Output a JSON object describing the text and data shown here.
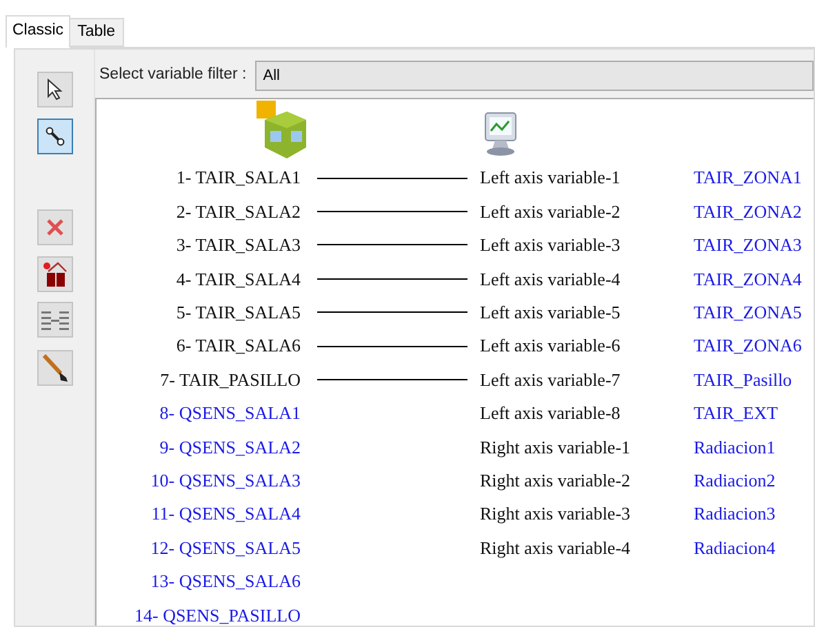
{
  "tabs": [
    {
      "label": "Classic",
      "selected": true
    },
    {
      "label": "Table",
      "selected": false
    }
  ],
  "tools": [
    {
      "kind": "pointer",
      "selected": false
    },
    {
      "kind": "link",
      "selected": true
    },
    {
      "kind": "delete",
      "selected": false
    },
    {
      "kind": "remove-all",
      "selected": false
    },
    {
      "kind": "align",
      "selected": false
    },
    {
      "kind": "brush",
      "selected": false
    }
  ],
  "filter": {
    "label": "Select variable filter :",
    "value": "All"
  },
  "sources": [
    {
      "label": "1- TAIR_SALA1",
      "connected": true
    },
    {
      "label": "2- TAIR_SALA2",
      "connected": true
    },
    {
      "label": "3- TAIR_SALA3",
      "connected": true
    },
    {
      "label": "4- TAIR_SALA4",
      "connected": true
    },
    {
      "label": "5- TAIR_SALA5",
      "connected": true
    },
    {
      "label": "6- TAIR_SALA6",
      "connected": true
    },
    {
      "label": "7- TAIR_PASILLO",
      "connected": true
    },
    {
      "label": "8- QSENS_SALA1",
      "connected": false
    },
    {
      "label": "9- QSENS_SALA2",
      "connected": false
    },
    {
      "label": "10- QSENS_SALA3",
      "connected": false
    },
    {
      "label": "11- QSENS_SALA4",
      "connected": false
    },
    {
      "label": "12- QSENS_SALA5",
      "connected": false
    },
    {
      "label": "13- QSENS_SALA6",
      "connected": false
    },
    {
      "label": "14- QSENS_PASILLO",
      "connected": false
    }
  ],
  "targets": [
    {
      "label": "Left axis variable-1",
      "variable": "TAIR_ZONA1"
    },
    {
      "label": "Left axis variable-2",
      "variable": "TAIR_ZONA2"
    },
    {
      "label": "Left axis variable-3",
      "variable": "TAIR_ZONA3"
    },
    {
      "label": "Left axis variable-4",
      "variable": "TAIR_ZONA4"
    },
    {
      "label": "Left axis variable-5",
      "variable": "TAIR_ZONA5"
    },
    {
      "label": "Left axis variable-6",
      "variable": "TAIR_ZONA6"
    },
    {
      "label": "Left axis variable-7",
      "variable": "TAIR_Pasillo"
    },
    {
      "label": "Left axis variable-8",
      "variable": "TAIR_EXT"
    },
    {
      "label": "Right axis variable-1",
      "variable": "Radiacion1"
    },
    {
      "label": "Right axis variable-2",
      "variable": "Radiacion2"
    },
    {
      "label": "Right axis variable-3",
      "variable": "Radiacion3"
    },
    {
      "label": "Right axis variable-4",
      "variable": "Radiacion4"
    }
  ]
}
